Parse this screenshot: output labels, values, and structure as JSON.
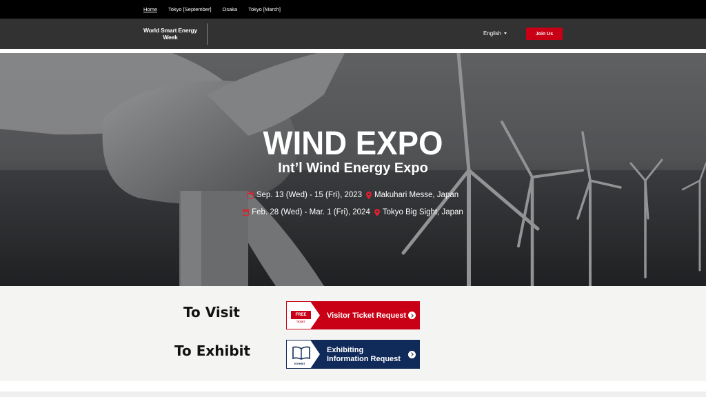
{
  "topnav": {
    "links": [
      "Home",
      "Tokyo [September]",
      "Osaka",
      "Tokyo [March]"
    ]
  },
  "header": {
    "logo_line1": "World Smart Energy",
    "logo_line2": "Week",
    "language": "English",
    "join_label": "Join Us"
  },
  "hero": {
    "title": "WIND EXPO",
    "subtitle": "Int’l Wind Energy Expo",
    "events": [
      {
        "dates": "Sep. 13 (Wed) - 15 (Fri), 2023",
        "venue": "Makuhari Messe, Japan"
      },
      {
        "dates": "Feb. 28 (Wed) - Mar. 1 (Fri), 2024",
        "venue": "Tokyo Big Sight, Japan"
      }
    ]
  },
  "actions": {
    "visit_label": "To Visit",
    "exhibit_label": "To Exhibit",
    "ticket_badge": "FREE",
    "ticket_badge_sub": "TICKET",
    "ticket_button": "Visitor Ticket Request",
    "exhibit_icon_sub": "EXHIBIT",
    "exhibit_button_line1": "Exhibiting",
    "exhibit_button_line2": "Information Request"
  },
  "colors": {
    "accent_red": "#c90015",
    "navy": "#102a5a",
    "header_bg": "#333232",
    "topnav_bg": "#000000"
  },
  "icons": [
    "calendar-icon",
    "map-pin-icon",
    "arrow-circle-icon",
    "book-icon",
    "caret-down-icon"
  ]
}
